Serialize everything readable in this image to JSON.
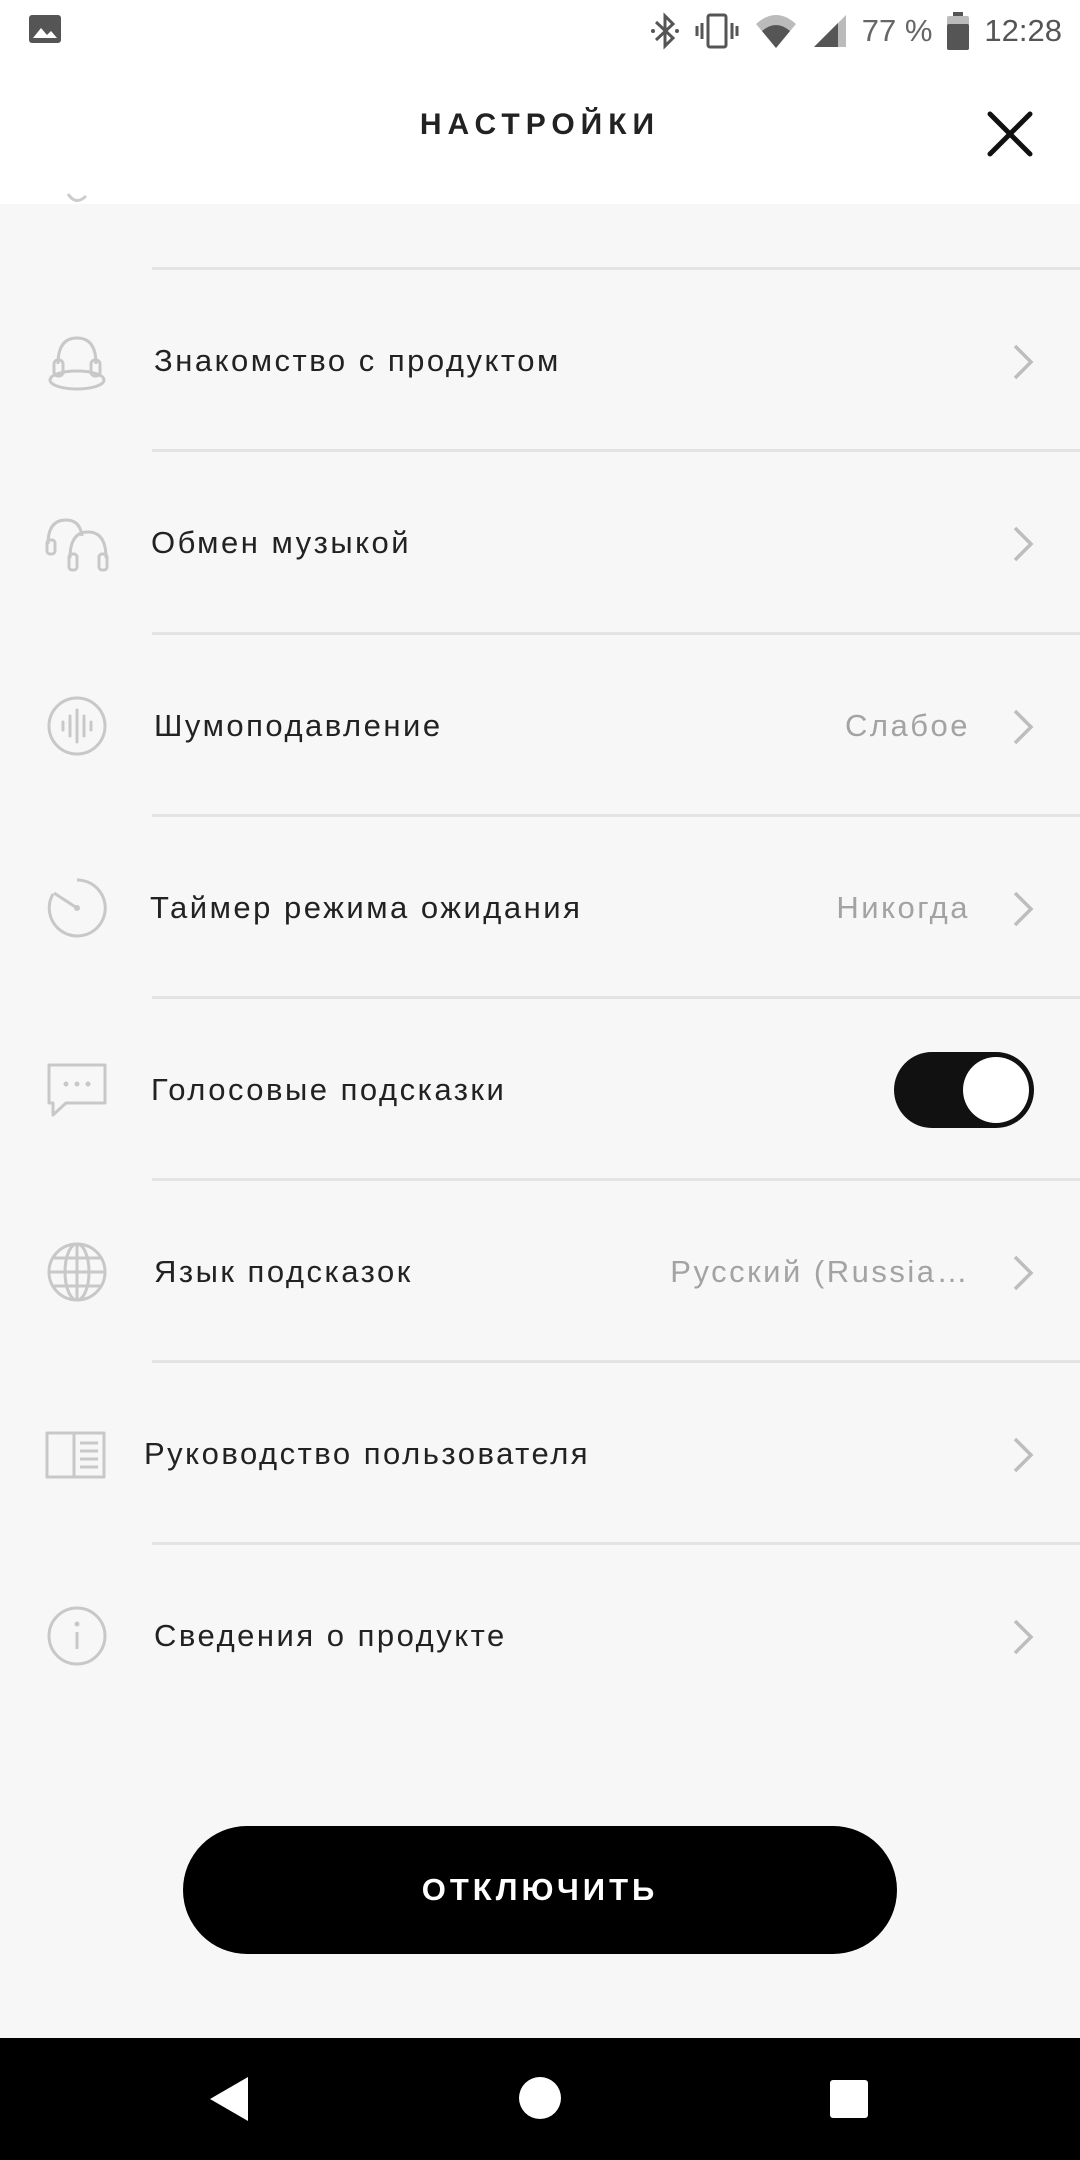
{
  "status_bar": {
    "battery_text": "77 %",
    "time": "12:28",
    "icons": [
      "gallery-icon",
      "bluetooth-icon",
      "vibrate-icon",
      "wifi-icon",
      "cell-signal-icon",
      "battery-icon"
    ]
  },
  "header": {
    "title": "НАСТРОЙКИ",
    "close_icon": "close-icon"
  },
  "settings": {
    "items": [
      {
        "label": "Знакомство с продуктом",
        "value": "",
        "icon": "headphones-tour-icon",
        "control": "chevron"
      },
      {
        "label": "Обмен музыкой",
        "value": "",
        "icon": "headphones-share-icon",
        "control": "chevron"
      },
      {
        "label": "Шумоподавление",
        "value": "Слабое",
        "icon": "noise-cancel-icon",
        "control": "chevron"
      },
      {
        "label": "Таймер режима ожидания",
        "value": "Никогда",
        "icon": "timer-icon",
        "control": "chevron"
      },
      {
        "label": "Голосовые подсказки",
        "value": "",
        "icon": "voice-prompt-icon",
        "control": "toggle",
        "enabled": true
      },
      {
        "label": "Язык подсказок",
        "value": "Русский (Russia…",
        "icon": "globe-icon",
        "control": "chevron"
      },
      {
        "label": "Руководство пользователя",
        "value": "",
        "icon": "book-icon",
        "control": "chevron"
      },
      {
        "label": "Сведения о продукте",
        "value": "",
        "icon": "info-icon",
        "control": "chevron"
      }
    ]
  },
  "disconnect_label": "ОТКЛЮЧИТЬ",
  "nav_bar": {
    "icons": [
      "back-icon",
      "home-icon",
      "recents-icon"
    ]
  }
}
